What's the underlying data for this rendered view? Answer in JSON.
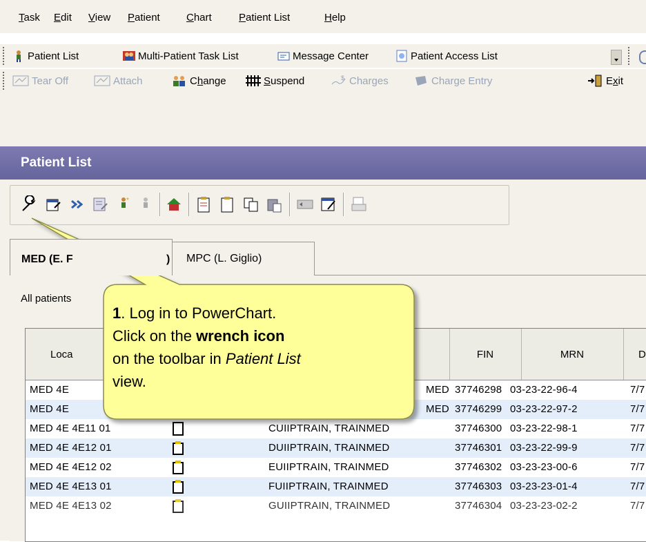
{
  "menu": [
    {
      "label": "Task",
      "u": "T",
      "rest": "ask"
    },
    {
      "label": "Edit",
      "u": "E",
      "rest": "dit"
    },
    {
      "label": "View",
      "u": "V",
      "rest": "iew"
    },
    {
      "label": "Patient",
      "u": "P",
      "rest": "atient"
    },
    {
      "label": "Chart",
      "u": "C",
      "rest": "hart"
    },
    {
      "label": "Patient List",
      "u": "P",
      "rest": "atient List"
    },
    {
      "label": "Help",
      "u": "H",
      "rest": "elp"
    }
  ],
  "toolbar1": {
    "patient_list": "Patient List",
    "multi_patient": "Multi-Patient Task List",
    "message_center": "Message Center",
    "patient_access": "Patient Access List"
  },
  "toolbar2": {
    "tear_off": "Tear Off",
    "attach": "Attach",
    "change_pre": "C",
    "change_u": "h",
    "change_post": "ange",
    "suspend_u": "S",
    "suspend_post": "uspend",
    "charges": "Charges",
    "charge_entry": "Charge Entry",
    "exit_pre": "E",
    "exit_u": "x",
    "exit_post": "it"
  },
  "title": "Patient List",
  "tabs": {
    "med": "MED  (E. F",
    "med_suffix": ")",
    "mpc": "MPC  (L. Giglio)"
  },
  "all_patients": "All patients",
  "columns": {
    "location": "Loca",
    "fin": "FIN",
    "mrn": "MRN",
    "d": "D"
  },
  "rows": [
    {
      "loc": "MED 4E",
      "name": "MED",
      "fin": "37746298",
      "mrn": "03-23-22-96-4",
      "date": "7/7"
    },
    {
      "loc": "MED 4E",
      "name": "MED",
      "fin": "37746299",
      "mrn": "03-23-22-97-2",
      "date": "7/7"
    },
    {
      "loc": "MED 4E 4E11 01",
      "name": "CUIIPTRAIN, TRAINMED",
      "fin": "37746300",
      "mrn": "03-23-22-98-1",
      "date": "7/7"
    },
    {
      "loc": "MED 4E 4E12 01",
      "name": "DUIIPTRAIN, TRAINMED",
      "fin": "37746301",
      "mrn": "03-23-22-99-9",
      "date": "7/7"
    },
    {
      "loc": "MED 4E 4E12 02",
      "name": "EUIIPTRAIN, TRAINMED",
      "fin": "37746302",
      "mrn": "03-23-23-00-6",
      "date": "7/7"
    },
    {
      "loc": "MED 4E 4E13 01",
      "name": "FUIIPTRAIN, TRAINMED",
      "fin": "37746303",
      "mrn": "03-23-23-01-4",
      "date": "7/7"
    },
    {
      "loc": "MED 4E 4E13 02",
      "name": "GUIIPTRAIN, TRAINMED",
      "fin": "37746304",
      "mrn": "03-23-23-02-2",
      "date": "7/7"
    }
  ],
  "callout": {
    "step": "1",
    "line1": ". Log in to PowerChart.",
    "line2_pre": "Click on the ",
    "line2_bold": "wrench icon",
    "line3": "on the toolbar in ",
    "line3_italic": "Patient List",
    "line4": "view."
  },
  "colors": {
    "title_bar": "#6d6ba4",
    "callout_fill": "#ffff99",
    "row_alt": "#e4eefb",
    "panel": "#f3f1ea"
  }
}
